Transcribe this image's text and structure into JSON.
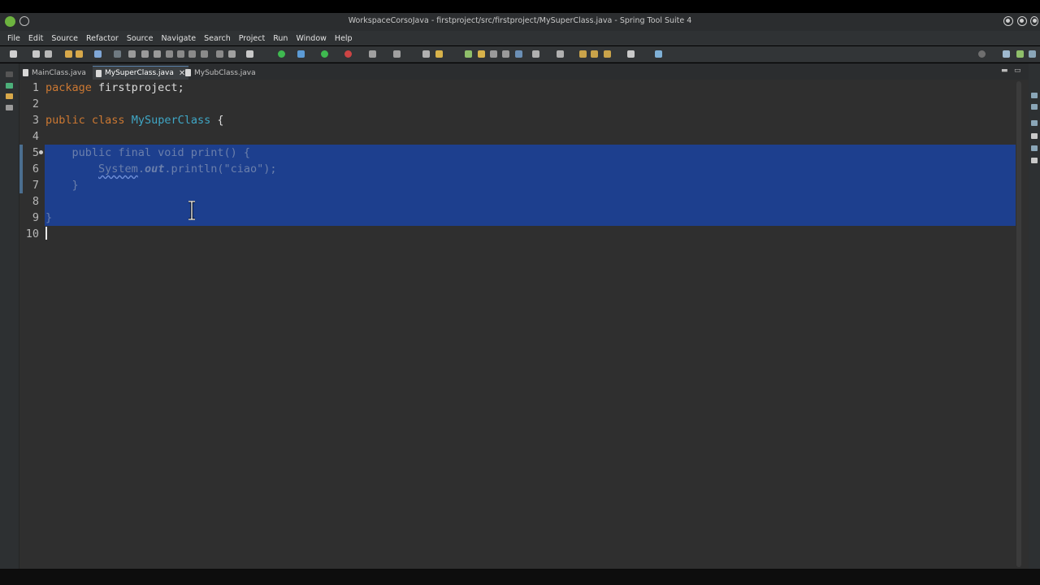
{
  "window": {
    "title": "WorkspaceCorsoJava - firstproject/src/firstproject/MySuperClass.java - Spring Tool Suite 4"
  },
  "menu": [
    "File",
    "Edit",
    "Source",
    "Refactor",
    "Source",
    "Navigate",
    "Search",
    "Project",
    "Run",
    "Window",
    "Help"
  ],
  "tabs": [
    {
      "label": "MainClass.java",
      "active": false
    },
    {
      "label": "MySuperClass.java",
      "active": true,
      "close": "✕"
    },
    {
      "label": "MySubClass.java",
      "active": false
    }
  ],
  "editor": {
    "line_numbers": [
      "1",
      "2",
      "3",
      "4",
      "5",
      "6",
      "7",
      "8",
      "9",
      "10"
    ],
    "lines": {
      "l1": {
        "keyword": "package",
        "rest": " firstproject;"
      },
      "l3": {
        "kw1": "public",
        "kw2": "class",
        "classname": "MySuperClass",
        "rest": " {"
      },
      "l5": {
        "text": "    public final void print() {"
      },
      "l6": {
        "indent": "        ",
        "system": "System",
        "dot1": ".",
        "out": "out",
        "rest": ".println(\"ciao\");"
      },
      "l7": {
        "text": "    }"
      },
      "l9": {
        "text": "}"
      }
    },
    "selected_lines": "5-9"
  },
  "colors": {
    "editor_bg": "#2f2f2f",
    "selection": "#1d3f8e",
    "keyword": "#cc7832",
    "class_name": "#3fa7c6",
    "spring_green": "#6db33f"
  }
}
